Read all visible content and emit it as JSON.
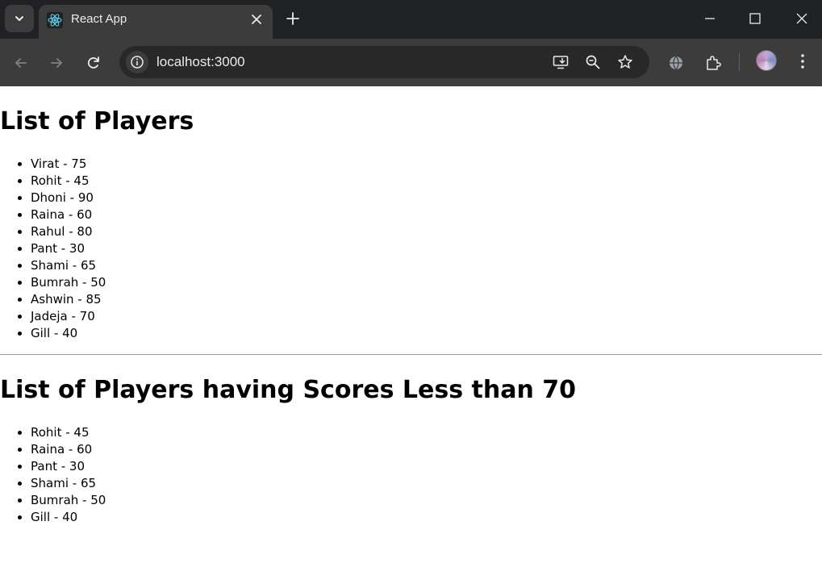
{
  "browser": {
    "tab": {
      "title": "React App",
      "favicon": "react-icon"
    },
    "url": "localhost:3000",
    "icons": [
      "tab-search-icon",
      "close-icon",
      "plus-icon",
      "minimize-icon",
      "maximize-icon",
      "window-close-icon",
      "back-icon",
      "forward-icon",
      "reload-icon",
      "site-info-icon",
      "install-icon",
      "zoom-out-icon",
      "star-icon",
      "translate-icon",
      "extensions-icon",
      "avatar",
      "more-vert-icon"
    ]
  },
  "page": {
    "heading_all": "List of Players",
    "players_all": [
      "Virat - 75",
      "Rohit - 45",
      "Dhoni - 90",
      "Raina - 60",
      "Rahul - 80",
      "Pant - 30",
      "Shami - 65",
      "Bumrah - 50",
      "Ashwin - 85",
      "Jadeja - 70",
      "Gill - 40"
    ],
    "heading_filtered": "List of Players having Scores Less than 70",
    "players_filtered": [
      "Rohit - 45",
      "Raina - 60",
      "Pant - 30",
      "Shami - 65",
      "Bumrah - 50",
      "Gill - 40"
    ]
  }
}
